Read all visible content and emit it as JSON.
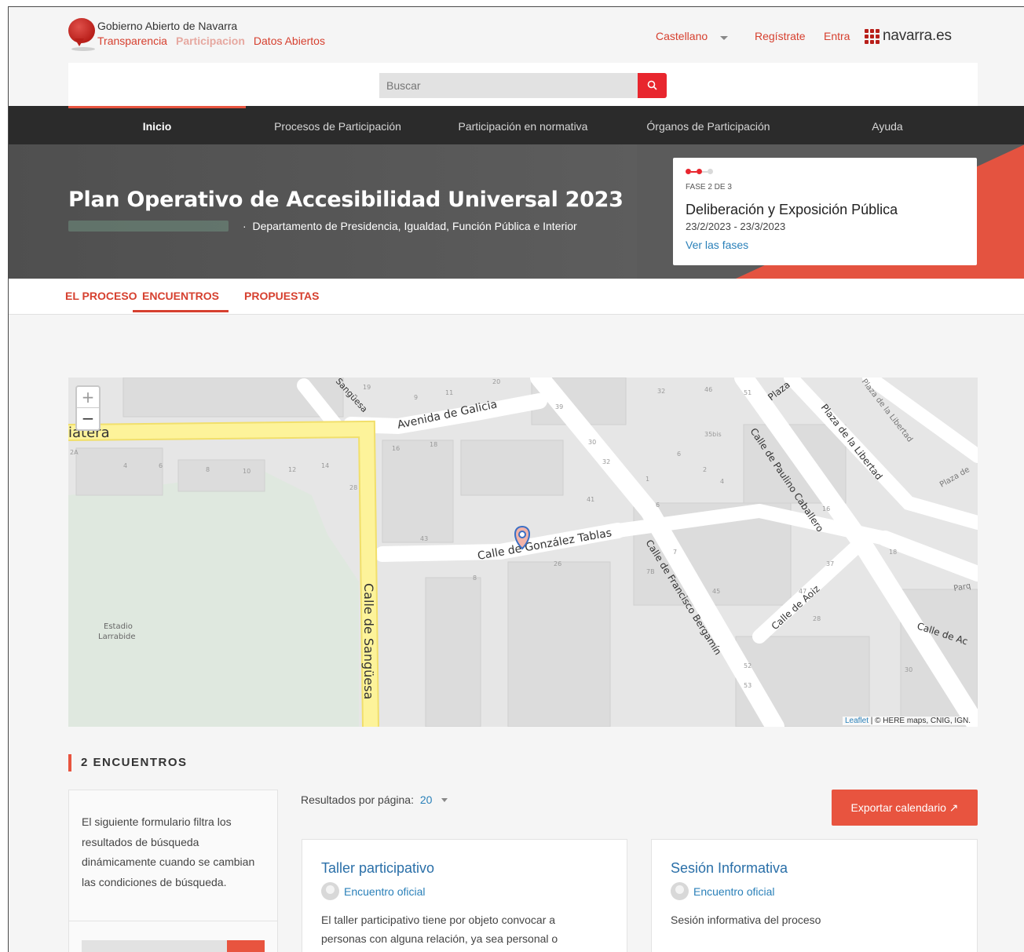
{
  "header": {
    "site_title": "Gobierno Abierto de Navarra",
    "links": [
      "Transparencia",
      "Participacion",
      "Datos Abiertos"
    ],
    "language": "Castellano",
    "register": "Regístrate",
    "login": "Entra",
    "brand": "navarra.es"
  },
  "search": {
    "placeholder": "Buscar"
  },
  "nav": {
    "items": [
      "Inicio",
      "Procesos de Participación",
      "Participación en normativa",
      "Órganos de Participación",
      "Ayuda"
    ],
    "active": "Inicio"
  },
  "hero": {
    "title": "Plan Operativo de Accesibilidad Universal 2023",
    "department": "Departamento de Presidencia, Igualdad, Función Pública e Interior",
    "phase": {
      "label": "FASE 2 DE 3",
      "name": "Deliberación y Exposición Pública",
      "dates": "23/2/2023 - 23/3/2023",
      "link": "Ver las fases"
    }
  },
  "subnav": {
    "tabs": [
      "EL PROCESO",
      "ENCUENTROS",
      "PROPUESTAS"
    ],
    "active": "ENCUENTROS"
  },
  "map": {
    "zoom_in": "+",
    "zoom_out": "−",
    "streets": [
      "Avenida de Galicia",
      "Calle de González Tablas",
      "Calle de Sangüesa",
      "Calle de Francisco Bergamín",
      "Calle de Paulino Caballero",
      "Plaza de la Libertad",
      "Calle de Aoiz",
      "Plaza",
      "Sangüesa",
      "Plaza de la Libertad",
      "Plaza de",
      "Calle de Ac",
      "Parq",
      "iatera"
    ],
    "place": [
      "Estadio",
      "Larrabide"
    ],
    "numbers": [
      "19",
      "9",
      "11",
      "20",
      "39",
      "46",
      "51",
      "16",
      "18",
      "2A",
      "4",
      "6",
      "8",
      "10",
      "12",
      "14",
      "28",
      "30",
      "32",
      "41",
      "43",
      "26",
      "8",
      "7",
      "7B",
      "45",
      "28",
      "47",
      "37",
      "16",
      "18",
      "52",
      "53",
      "30",
      "32",
      "35bis",
      "6",
      "2",
      "4",
      "6",
      "1",
      "3",
      "5"
    ],
    "attribution_leaflet": "Leaflet",
    "attribution_rest": " | © HERE maps, CNIG, IGN."
  },
  "encuentros": {
    "section_title": "2 ENCUENTROS",
    "filter_text": "El siguiente formulario filtra los resultados de búsqueda dinámicamente cuando se cambian las condiciones de búsqueda.",
    "per_page_label": "Resultados por página:",
    "per_page_value": "20",
    "export_label": "Exportar calendario ↗",
    "cards": [
      {
        "title": "Taller participativo",
        "owner": "Encuentro oficial",
        "description": "El taller participativo tiene por objeto convocar a personas con alguna relación, ya sea personal o"
      },
      {
        "title": "Sesión Informativa",
        "owner": "Encuentro oficial",
        "description": "Sesión informativa del proceso"
      }
    ]
  },
  "colors": {
    "accent": "#e8543f",
    "search_red": "#e8262e",
    "nav_bg": "#2b2b2b",
    "link_blue": "#2a80b9",
    "road_yellow": "#fdf39a"
  }
}
